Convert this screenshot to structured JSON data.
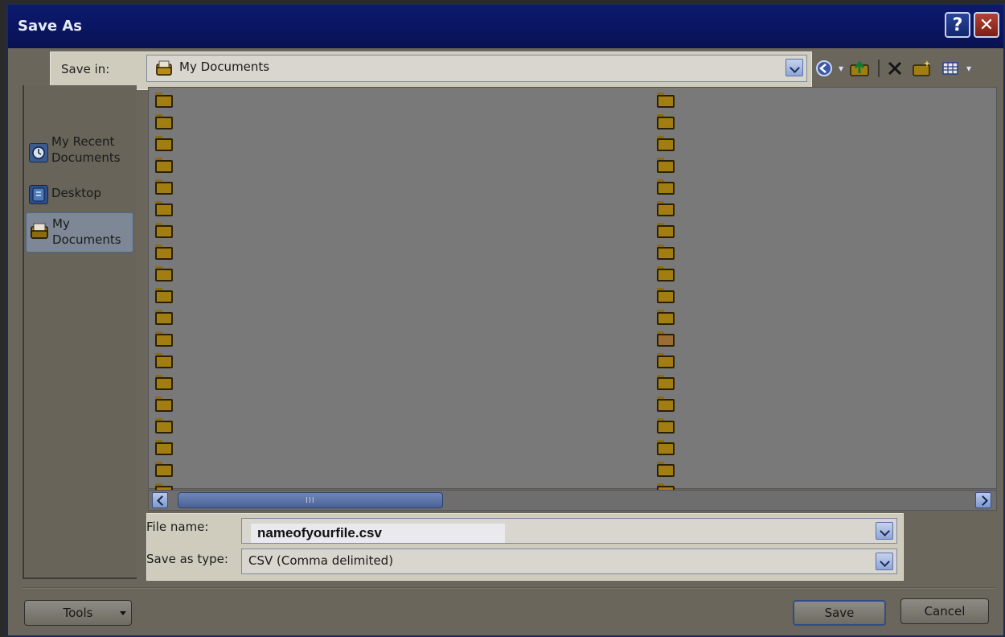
{
  "window": {
    "title": "Save As"
  },
  "title_buttons": {
    "help": "?",
    "close": "✕"
  },
  "save_in": {
    "label": "Save in:",
    "value": "My Documents"
  },
  "toolbar": {
    "icons": [
      "back-icon",
      "up-folder-icon",
      "delete-icon",
      "new-folder-icon",
      "views-icon"
    ]
  },
  "places": [
    {
      "label": "My Recent Documents"
    },
    {
      "label": "Desktop"
    },
    {
      "label": "My Documents"
    }
  ],
  "file_list": {
    "column1_folder_count": 19,
    "column2_folder_count": 19
  },
  "file_name": {
    "label": "File name:",
    "value": "nameofyourfile.csv"
  },
  "save_as_type": {
    "label": "Save as type:",
    "value": "CSV (Comma delimited)"
  },
  "buttons": {
    "tools": "Tools",
    "save": "Save",
    "cancel": "Cancel"
  },
  "scrollbar": {
    "grip": "III"
  }
}
